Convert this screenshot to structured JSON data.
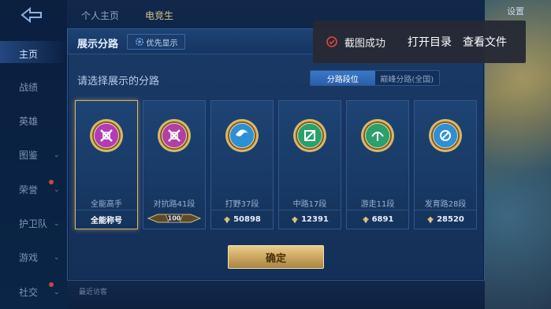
{
  "header": {
    "personal_tab": "个人主页",
    "other_tab": "电竞生",
    "settings": "设置"
  },
  "nav": {
    "items": [
      {
        "label": "主页",
        "active": true,
        "chevron": false,
        "dot": false
      },
      {
        "label": "战绩",
        "active": false,
        "chevron": false,
        "dot": false
      },
      {
        "label": "英雄",
        "active": false,
        "chevron": false,
        "dot": false
      },
      {
        "label": "图鉴",
        "active": false,
        "chevron": true,
        "dot": false
      },
      {
        "label": "荣誉",
        "active": false,
        "chevron": true,
        "dot": true
      },
      {
        "label": "护卫队",
        "active": false,
        "chevron": true,
        "dot": false
      },
      {
        "label": "游戏",
        "active": false,
        "chevron": true,
        "dot": false
      },
      {
        "label": "社交",
        "active": false,
        "chevron": true,
        "dot": true
      }
    ]
  },
  "panel": {
    "title": "展示分路",
    "priority_button": "优先显示",
    "subtitle": "请选择展示的分路",
    "toggle": {
      "options": [
        "分路段位",
        "巅峰分路(全国)"
      ],
      "active_index": 0
    },
    "cards": [
      {
        "label": "全能高手",
        "footer": "全能称号",
        "emblem_color": "#b43bb8",
        "footer_type": "text",
        "selected": true
      },
      {
        "label": "对抗路41段",
        "footer": "100",
        "emblem_color": "#b33ea6",
        "footer_type": "rank",
        "selected": false
      },
      {
        "label": "打野37段",
        "footer": "50898",
        "emblem_color": "#2d8fd6",
        "footer_type": "score",
        "selected": false
      },
      {
        "label": "中路17段",
        "footer": "12391",
        "emblem_color": "#2aa06c",
        "footer_type": "score",
        "selected": false
      },
      {
        "label": "游走11段",
        "footer": "6891",
        "emblem_color": "#2aa06c",
        "footer_type": "score",
        "selected": false
      },
      {
        "label": "发育路28段",
        "footer": "28520",
        "emblem_color": "#2d8fd6",
        "footer_type": "score",
        "selected": false
      }
    ],
    "confirm_button": "确定"
  },
  "toast": {
    "message": "截图成功",
    "open_dir": "打开目录",
    "view_file": "查看文件",
    "icon_color": "#e0453a"
  },
  "bottom": {
    "text": "最近访客"
  }
}
